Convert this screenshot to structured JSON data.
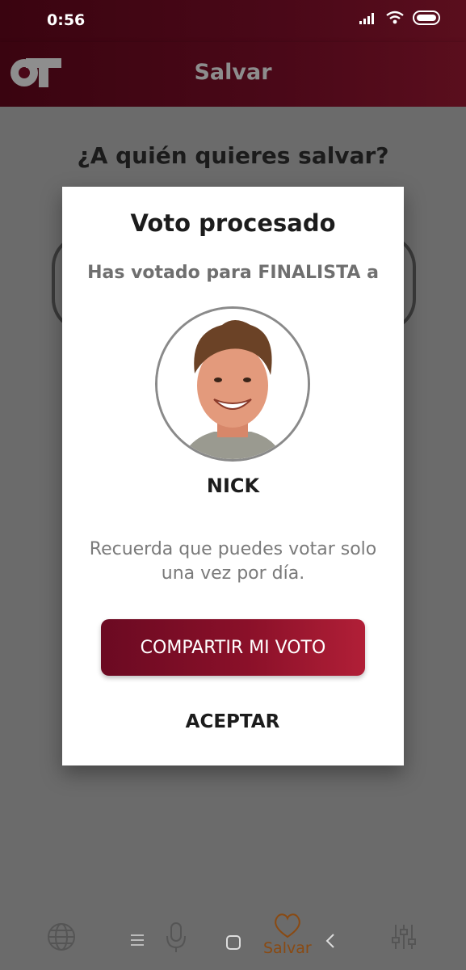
{
  "status_bar": {
    "time": "0:56"
  },
  "app_bar": {
    "title": "Salvar"
  },
  "page": {
    "question": "¿A quién quieres salvar?"
  },
  "dialog": {
    "title": "Voto procesado",
    "subtitle": "Has votado para FINALISTA a",
    "candidate_name": "NICK",
    "reminder": "Recuerda que puedes votar solo una vez por día.",
    "share_label": "COMPARTIR MI VOTO",
    "accept_label": "ACEPTAR"
  },
  "bottom_nav": {
    "active_label": "Salvar"
  },
  "colors": {
    "brand": "#7a0c25",
    "accent_text": "#8a4a12",
    "overlay": "#6b6b6b"
  }
}
